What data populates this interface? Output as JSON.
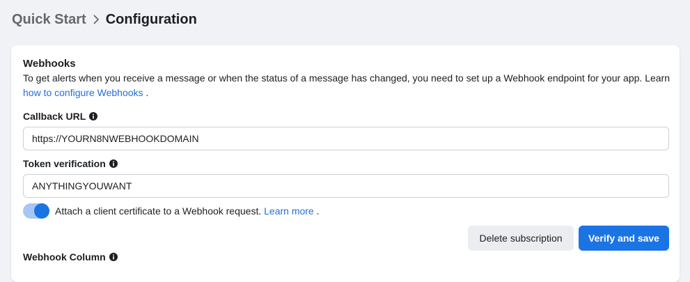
{
  "breadcrumb": {
    "parent": "Quick Start",
    "current": "Configuration"
  },
  "webhooks": {
    "title": "Webhooks",
    "description": "To get alerts when you receive a message or when the status of a message has changed, you need to set up a Webhook endpoint for your app. Learn ",
    "description_link": "how to configure Webhooks",
    "description_end": " ."
  },
  "callback": {
    "label": "Callback URL",
    "value": "https://YOURN8NWEBHOOKDOMAIN"
  },
  "token": {
    "label": "Token verification",
    "value": "ANYTHINGYOUWANT"
  },
  "certificate": {
    "text": "Attach a client certificate to a Webhook request. ",
    "link": "Learn more",
    "end": " .",
    "enabled": true
  },
  "buttons": {
    "delete": "Delete subscription",
    "verify": "Verify and save"
  },
  "webhook_column": {
    "label": "Webhook Column"
  },
  "colors": {
    "primary": "#1b74e4",
    "link": "#216fdb",
    "background": "#f0f2f5"
  }
}
